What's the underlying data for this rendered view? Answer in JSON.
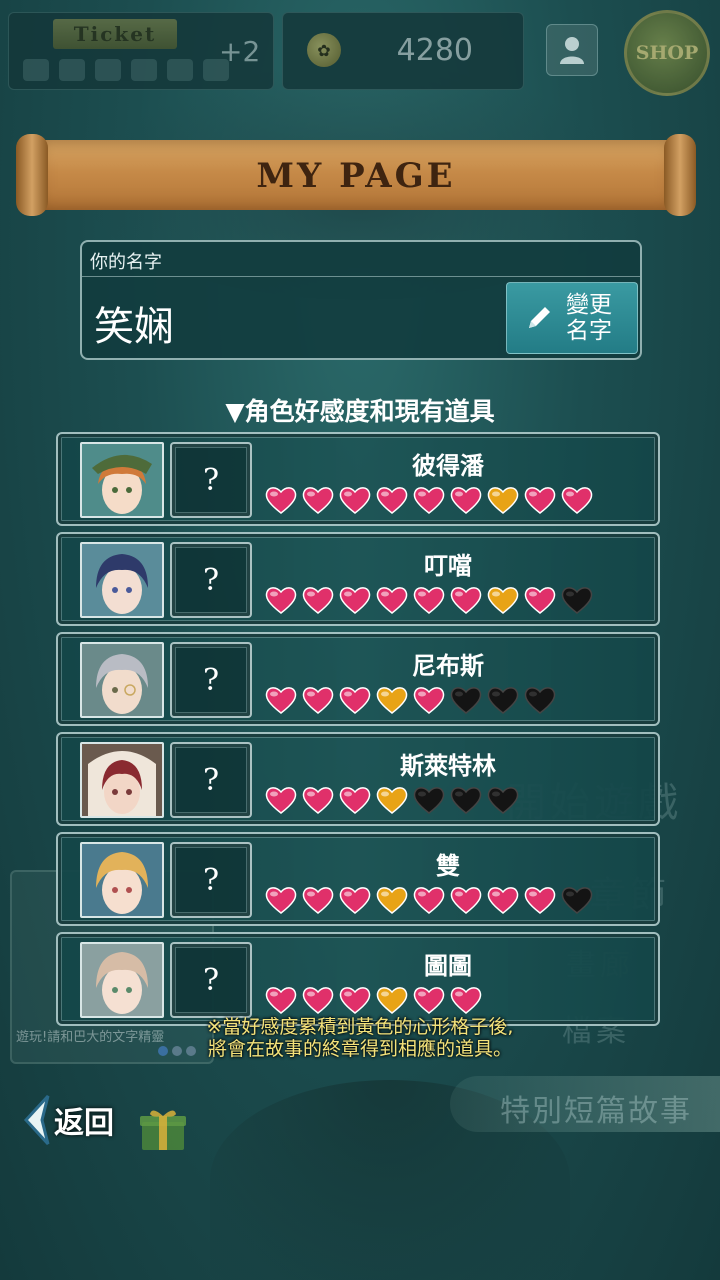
{
  "topbar": {
    "ticket_label": "Ticket",
    "ticket_plus": "+2",
    "coin_value": "4280",
    "shop_label": "SHOP"
  },
  "banner": {
    "title": "MY PAGE"
  },
  "profile": {
    "name_label": "你的名字",
    "name_value": "笑娴",
    "rename_line1": "變更",
    "rename_line2": "名字"
  },
  "section_title": "▼角色好感度和現有道具",
  "characters": [
    {
      "name": "彼得潘",
      "item": "?",
      "hearts": [
        "pink",
        "pink",
        "pink",
        "pink",
        "pink",
        "pink",
        "gold",
        "pink",
        "pink"
      ]
    },
    {
      "name": "叮噹",
      "item": "?",
      "hearts": [
        "pink",
        "pink",
        "pink",
        "pink",
        "pink",
        "pink",
        "gold",
        "pink",
        "black"
      ]
    },
    {
      "name": "尼布斯",
      "item": "?",
      "hearts": [
        "pink",
        "pink",
        "pink",
        "gold",
        "pink",
        "black",
        "black",
        "black"
      ]
    },
    {
      "name": "斯萊特林",
      "item": "?",
      "hearts": [
        "pink",
        "pink",
        "pink",
        "gold",
        "black",
        "black",
        "black"
      ]
    },
    {
      "name": "雙",
      "item": "?",
      "hearts": [
        "pink",
        "pink",
        "pink",
        "gold",
        "pink",
        "pink",
        "pink",
        "pink",
        "black"
      ]
    },
    {
      "name": "圖圖",
      "item": "?",
      "hearts": [
        "pink",
        "pink",
        "pink",
        "gold",
        "pink",
        "pink"
      ]
    }
  ],
  "note": {
    "line1": "※當好感度累積到黃色的心形格子後,",
    "line2": "將會在故事的終章得到相應的道具。"
  },
  "background_menu": [
    "開始遊戲",
    "章節",
    "畫廊",
    "檔案",
    "特別短篇故事"
  ],
  "background_panel_text": "遊玩!請和巴大的文字精靈",
  "bottom": {
    "back_label": "返回"
  },
  "colors": {
    "pink_heart": "#e0306a",
    "gold_heart": "#e8a316",
    "black_heart": "#141414",
    "accent": "#2a8a94"
  }
}
